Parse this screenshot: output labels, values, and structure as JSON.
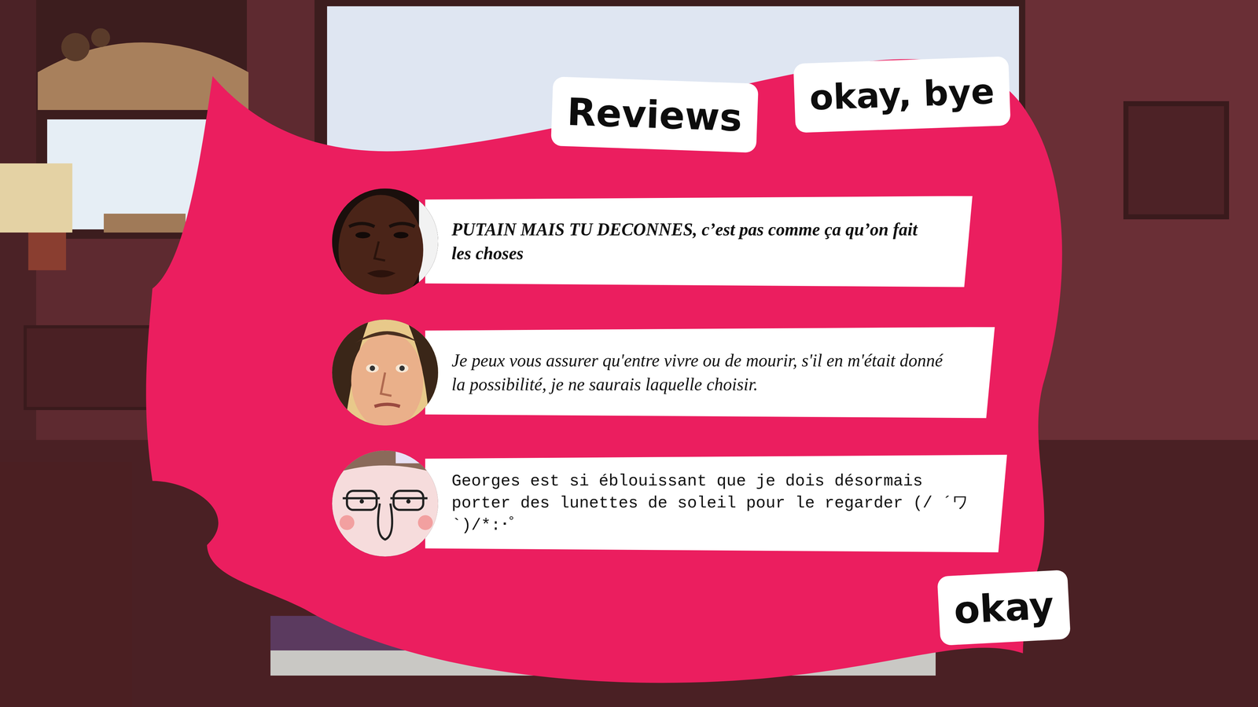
{
  "title": "Reviews",
  "buttons": [
    {
      "label": "okay, bye"
    },
    {
      "label": "okay"
    }
  ],
  "reviews": [
    {
      "text": "PUTAIN MAIS TU DECONNES, c’est pas comme ça qu’on fait les choses",
      "kind": "bold"
    },
    {
      "text": "Je peux vous assurer qu'entre vivre ou de mourir, s'il en m'était donné la possibilité, je ne saurais laquelle choisir.",
      "kind": "italic"
    },
    {
      "text": "Georges est si éblouissant que je dois désormais porter des lunettes de soleil pour le regarder (/ ´ワ`)/*:･ﾟ",
      "kind": "mono"
    }
  ]
}
